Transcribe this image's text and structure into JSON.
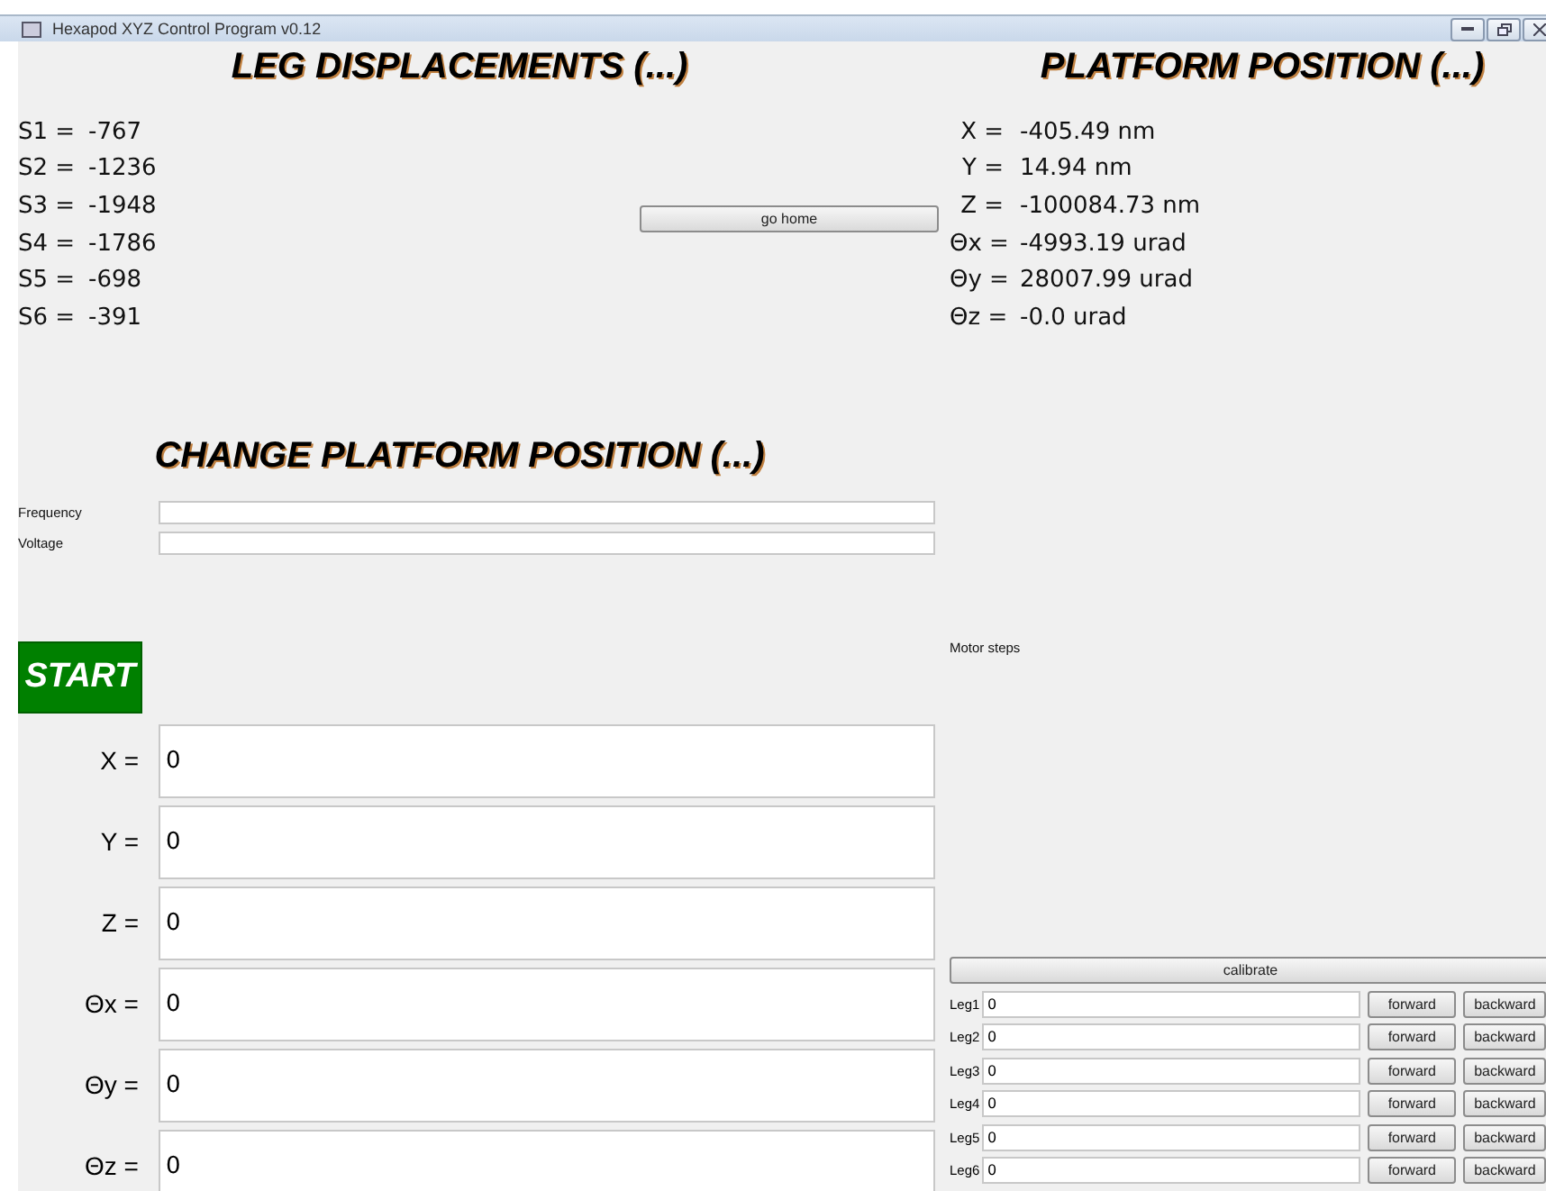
{
  "window": {
    "title": "Hexapod XYZ Control Program v0.12"
  },
  "leg_displacements": {
    "title": "LEG DISPLACEMENTS (...)",
    "rows": [
      {
        "label": "S1 =",
        "value": "-767"
      },
      {
        "label": "S2 =",
        "value": "-1236"
      },
      {
        "label": "S3 =",
        "value": "-1948"
      },
      {
        "label": "S4 =",
        "value": "-1786"
      },
      {
        "label": "S5 =",
        "value": "-698"
      },
      {
        "label": "S6 =",
        "value": "-391"
      }
    ]
  },
  "go_home_button": "go home",
  "platform_position": {
    "title": "PLATFORM POSITION (...)",
    "rows": [
      {
        "label": "X =",
        "value": "-405.49 nm"
      },
      {
        "label": "Y =",
        "value": "14.94 nm"
      },
      {
        "label": "Z =",
        "value": "-100084.73 nm"
      },
      {
        "label": "Θx =",
        "value": "-4993.19 urad"
      },
      {
        "label": "Θy =",
        "value": "28007.99 urad"
      },
      {
        "label": "Θz =",
        "value": "-0.0 urad"
      }
    ]
  },
  "change_position": {
    "title": "CHANGE PLATFORM POSITION (...)",
    "fields": [
      {
        "label": "Frequency"
      },
      {
        "label": "Voltage"
      }
    ],
    "start_button": "START",
    "coordinates": [
      {
        "label": "X =",
        "value": "0"
      },
      {
        "label": "Y =",
        "value": "0"
      },
      {
        "label": "Z =",
        "value": "0"
      },
      {
        "label": "Θx =",
        "value": "0"
      },
      {
        "label": "Θy =",
        "value": "0"
      },
      {
        "label": "Θz =",
        "value": "0"
      }
    ]
  },
  "motor_steps": {
    "label": "Motor steps",
    "calibrate_button": "calibrate",
    "legs": [
      {
        "label": "Leg1",
        "value": "0",
        "forward": "forward",
        "backward": "backward"
      },
      {
        "label": "Leg2",
        "value": "0",
        "forward": "forward",
        "backward": "backward"
      },
      {
        "label": "Leg3",
        "value": "0",
        "forward": "forward",
        "backward": "backward"
      },
      {
        "label": "Leg4",
        "value": "0",
        "forward": "forward",
        "backward": "backward"
      },
      {
        "label": "Leg5",
        "value": "0",
        "forward": "forward",
        "backward": "backward"
      },
      {
        "label": "Leg6",
        "value": "0",
        "forward": "forward",
        "backward": "backward"
      }
    ]
  }
}
